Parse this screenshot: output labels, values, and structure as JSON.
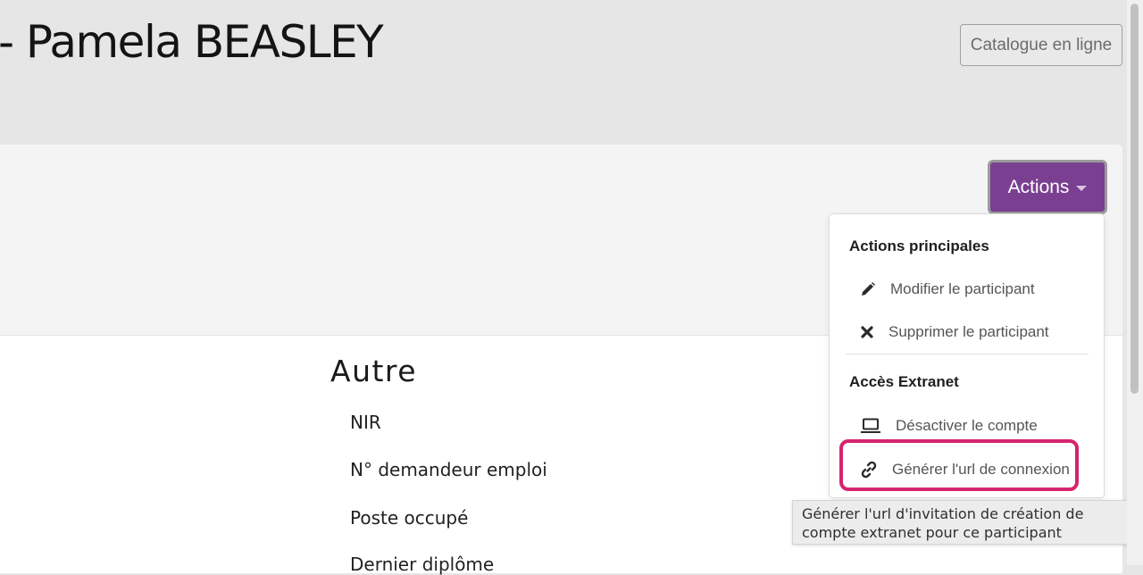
{
  "header": {
    "title": "- Pamela BEASLEY",
    "catalogue_button": "Catalogue en ligne"
  },
  "toolbar": {
    "actions_button": "Actions"
  },
  "dropdown": {
    "section_main": "Actions principales",
    "edit_label": "Modifier le participant",
    "delete_label": "Supprimer le participant",
    "section_extranet": "Accès Extranet",
    "deactivate_label": "Désactiver le compte",
    "generate_url_label": "Générer l'url de connexion"
  },
  "tooltip": {
    "text": "Générer l'url d'invitation de création de compte extranet pour ce participant"
  },
  "section": {
    "title": "Autre",
    "fields": [
      "NIR",
      "N° demandeur emploi",
      "Poste occupé",
      "Dernier diplôme"
    ]
  },
  "colors": {
    "accent": "#7a3f91",
    "highlight": "#d6246f"
  },
  "icons": [
    "pencil-icon",
    "times-icon",
    "laptop-icon",
    "link-icon",
    "caret-down-icon"
  ]
}
